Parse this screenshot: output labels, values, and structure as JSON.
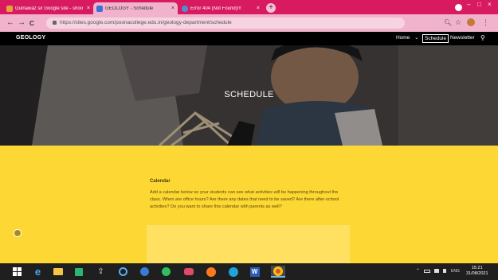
{
  "browser": {
    "tabs": [
      {
        "label": "Gulnawaz sir Google site - shoo",
        "favicon_color": "#e8a23c",
        "active": false
      },
      {
        "label": "GEOLOGY - Schedule",
        "favicon_color": "#3d6fd6",
        "active": true
      },
      {
        "label": "Error 404 (Not Found)!!!",
        "favicon_color": "#4a90d9",
        "active": false
      }
    ],
    "close_glyph": "×",
    "new_tab_glyph": "+",
    "url": "https://sites.google.com/poonacollege.edu.in/geology-department/schedule",
    "back_glyph": "←",
    "forward_glyph": "→",
    "reload_glyph": "C",
    "window_controls": {
      "minimize": "–",
      "maximize": "□",
      "close": "×"
    },
    "toolbar_icons": {
      "search": "🔍︎",
      "star": "☆",
      "menu": "⋮"
    }
  },
  "site": {
    "title": "GEOLOGY",
    "nav": [
      {
        "label": "Home",
        "has_dropdown": true
      },
      {
        "label": "Schedule",
        "current": true
      },
      {
        "label": "Newsletter"
      }
    ],
    "dropdown_glyph": "⌄",
    "search_glyph": "⚲"
  },
  "hero": {
    "title": "SCHEDULE"
  },
  "content": {
    "heading": "Calendar",
    "body": "Add a calendar below so your students can see what activities will be happening throughout the class. When are office hours? Are there any dates that need to be saved? Are there after-school activities? Do you want to share this calendar with parents as well?"
  },
  "taskbar": {
    "apps": [
      "windows-start",
      "internet-explorer",
      "file-explorer",
      "store",
      "upload",
      "app-blue-circle",
      "app-dark-circle",
      "whatsapp",
      "media",
      "firefox",
      "edge",
      "word",
      "chrome"
    ],
    "tray": {
      "chevron": "⌃",
      "lang": "ENG"
    },
    "time": "15:21",
    "date": "31/08/2021"
  }
}
